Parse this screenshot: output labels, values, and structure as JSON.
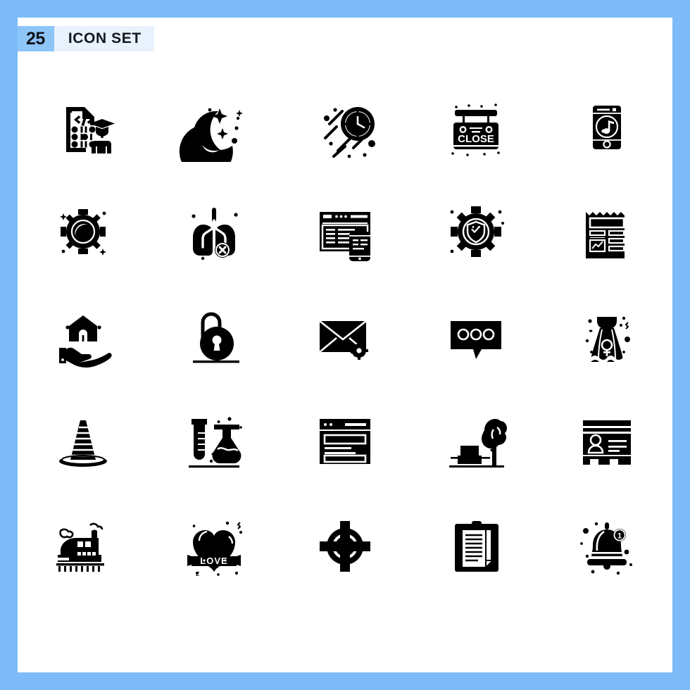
{
  "frame": {
    "border_color": "#7CBBF7",
    "sheet_color": "#ffffff"
  },
  "header": {
    "count": "25",
    "title": "ICON SET",
    "badge_color": "#8EC5F8",
    "strip_color": "#E8F2FC",
    "text_color": "#111318"
  },
  "grid": {
    "columns": 5,
    "rows": 5,
    "total_icons": 25,
    "icon_color": "#000000"
  },
  "icons": [
    {
      "index": 1,
      "name": "code-document-graduate-icon",
      "label": "Programming Education"
    },
    {
      "index": 2,
      "name": "crescent-moon-stars-icon",
      "label": "Night"
    },
    {
      "index": 3,
      "name": "fast-clock-motion-icon",
      "label": "Fast Time"
    },
    {
      "index": 4,
      "name": "close-sign-board-icon",
      "label": "Close Sign",
      "text": "CLOSE"
    },
    {
      "index": 5,
      "name": "mobile-music-player-icon",
      "label": "Mobile Music"
    },
    {
      "index": 6,
      "name": "gear-settings-sparkle-icon",
      "label": "Settings"
    },
    {
      "index": 7,
      "name": "lungs-disease-cross-icon",
      "label": "Lung Disease"
    },
    {
      "index": 8,
      "name": "responsive-web-mobile-icon",
      "label": "Responsive Design"
    },
    {
      "index": 9,
      "name": "gear-shield-security-icon",
      "label": "Security Settings"
    },
    {
      "index": 10,
      "name": "invoice-chart-report-icon",
      "label": "Financial Report"
    },
    {
      "index": 11,
      "name": "hand-holding-house-icon",
      "label": "Real Estate"
    },
    {
      "index": 12,
      "name": "open-padlock-keyhole-icon",
      "label": "Unlocked"
    },
    {
      "index": 13,
      "name": "mail-settings-gear-icon",
      "label": "Mail Settings"
    },
    {
      "index": 14,
      "name": "chat-bubble-typing-icon",
      "label": "Chat"
    },
    {
      "index": 15,
      "name": "woman-dress-female-icon",
      "label": "Dress"
    },
    {
      "index": 16,
      "name": "traffic-cone-icon",
      "label": "Traffic Cone"
    },
    {
      "index": 17,
      "name": "test-tube-flask-lab-icon",
      "label": "Laboratory"
    },
    {
      "index": 18,
      "name": "browser-window-form-icon",
      "label": "Web Page"
    },
    {
      "index": 19,
      "name": "park-bench-tree-icon",
      "label": "Park"
    },
    {
      "index": 20,
      "name": "user-profile-card-icon",
      "label": "Profile Card"
    },
    {
      "index": 21,
      "name": "train-locomotive-icon",
      "label": "Train"
    },
    {
      "index": 22,
      "name": "love-heart-banner-icon",
      "label": "Love",
      "text": "LOVE"
    },
    {
      "index": 23,
      "name": "target-crosshair-icon",
      "label": "Target"
    },
    {
      "index": 24,
      "name": "clipboard-documents-icon",
      "label": "Clipboard"
    },
    {
      "index": 25,
      "name": "notification-bell-badge-icon",
      "label": "Notification",
      "text": "1"
    }
  ]
}
